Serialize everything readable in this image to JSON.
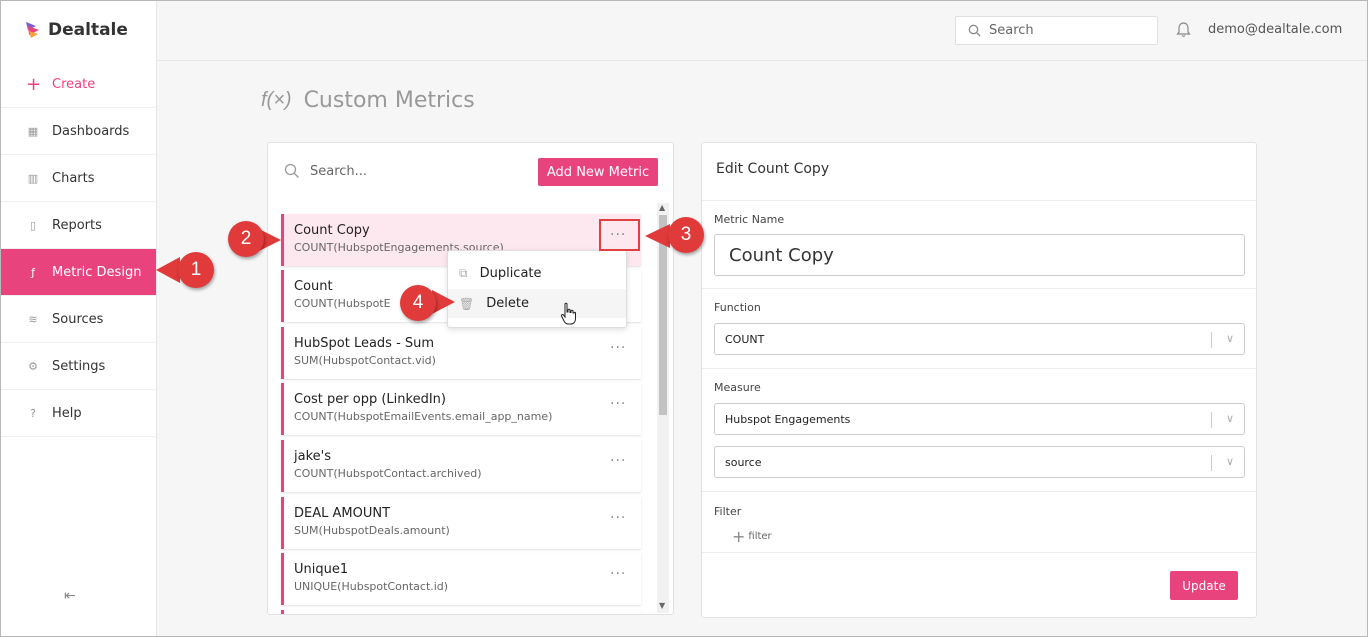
{
  "app": {
    "name": "Dealtale"
  },
  "sidebar": {
    "items": [
      {
        "label": "Create",
        "icon": "plus-icon"
      },
      {
        "label": "Dashboards",
        "icon": "grid-icon"
      },
      {
        "label": "Charts",
        "icon": "bar-chart-icon"
      },
      {
        "label": "Reports",
        "icon": "document-icon"
      },
      {
        "label": "Metric Design",
        "icon": "function-icon",
        "active": true
      },
      {
        "label": "Sources",
        "icon": "database-icon"
      },
      {
        "label": "Settings",
        "icon": "gear-icon"
      },
      {
        "label": "Help",
        "icon": "help-icon"
      }
    ],
    "collapse_icon": "collapse-left-icon"
  },
  "header": {
    "search_placeholder": "Search",
    "user_email": "demo@dealtale.com"
  },
  "page": {
    "title_icon": "f(×)",
    "title": "Custom Metrics"
  },
  "metrics_list": {
    "search_placeholder": "Search...",
    "add_button": "Add New Metric",
    "items": [
      {
        "name": "Count Copy",
        "formula": "COUNT(HubspotEngagements.source)",
        "selected": true
      },
      {
        "name": "Count",
        "formula": "COUNT(HubspotE"
      },
      {
        "name": "HubSpot Leads - Sum",
        "formula": "SUM(HubspotContact.vid)"
      },
      {
        "name": "Cost per opp (LinkedIn)",
        "formula": "COUNT(HubspotEmailEvents.email_app_name)"
      },
      {
        "name": "jake's",
        "formula": "COUNT(HubspotContact.archived)"
      },
      {
        "name": "DEAL AMOUNT",
        "formula": "SUM(HubspotDeals.amount)"
      },
      {
        "name": "Unique1",
        "formula": "UNIQUE(HubspotContact.id)"
      }
    ],
    "more_icon": "···"
  },
  "context_menu": {
    "items": [
      {
        "label": "Duplicate",
        "icon": "copy-icon"
      },
      {
        "label": "Delete",
        "icon": "trash-icon"
      }
    ]
  },
  "callouts": [
    "1",
    "2",
    "3",
    "4"
  ],
  "edit_panel": {
    "title": "Edit Count Copy",
    "metric_name_label": "Metric Name",
    "metric_name_value": "Count Copy",
    "function_label": "Function",
    "function_value": "COUNT",
    "measure_label": "Measure",
    "measure_value": "Hubspot Engagements",
    "measure_field_value": "source",
    "filter_label": "Filter",
    "filter_add": "filter",
    "update_button": "Update"
  },
  "colors": {
    "accent": "#e8437d",
    "callout": "#e03a3a"
  }
}
